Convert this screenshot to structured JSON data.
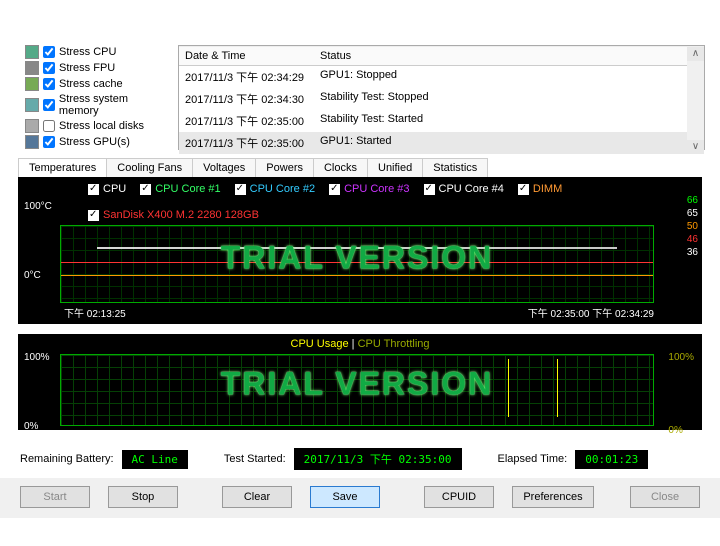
{
  "stress": {
    "cpu": {
      "label": "Stress CPU",
      "checked": true
    },
    "fpu": {
      "label": "Stress FPU",
      "checked": true
    },
    "cache": {
      "label": "Stress cache",
      "checked": true
    },
    "memory": {
      "label": "Stress system memory",
      "checked": true
    },
    "disks": {
      "label": "Stress local disks",
      "checked": false
    },
    "gpu": {
      "label": "Stress GPU(s)",
      "checked": true
    }
  },
  "log": {
    "col_datetime": "Date & Time",
    "col_status": "Status",
    "rows": [
      {
        "dt": "2017/11/3 下午 02:34:29",
        "status": "GPU1: Stopped"
      },
      {
        "dt": "2017/11/3 下午 02:34:30",
        "status": "Stability Test: Stopped"
      },
      {
        "dt": "2017/11/3 下午 02:35:00",
        "status": "Stability Test: Started"
      },
      {
        "dt": "2017/11/3 下午 02:35:00",
        "status": "GPU1: Started"
      }
    ]
  },
  "tabs": [
    "Temperatures",
    "Cooling Fans",
    "Voltages",
    "Powers",
    "Clocks",
    "Unified",
    "Statistics"
  ],
  "active_tab": "Temperatures",
  "temp_chart": {
    "legend": [
      {
        "name": "CPU",
        "color": "#ffffff"
      },
      {
        "name": "CPU Core #1",
        "color": "#33ff66"
      },
      {
        "name": "CPU Core #2",
        "color": "#33ccff"
      },
      {
        "name": "CPU Core #3",
        "color": "#cc33ff"
      },
      {
        "name": "CPU Core #4",
        "color": "#ffffff"
      },
      {
        "name": "DIMM",
        "color": "#ff9933"
      },
      {
        "name": "SanDisk X400 M.2 2280 128GB",
        "color": "#ff3333"
      }
    ],
    "y_top": "100°C",
    "y_bot": "0°C",
    "x_left": "下午 02:13:25",
    "x_right1": "下午 02:35:00",
    "x_right2": "下午 02:34:29",
    "right_vals": [
      {
        "v": "66",
        "c": "#0f0"
      },
      {
        "v": "65",
        "c": "#fff"
      },
      {
        "v": "50",
        "c": "#f90"
      },
      {
        "v": "46",
        "c": "#f33"
      },
      {
        "v": "36",
        "c": "#fff"
      }
    ],
    "watermark": "TRIAL VERSION"
  },
  "cpu_chart": {
    "legend_usage": "CPU Usage",
    "legend_sep": "|",
    "legend_throttling": "CPU Throttling",
    "y_top": "100%",
    "y_bot": "0%",
    "r_top": "100%",
    "r_bot": "0%",
    "watermark": "TRIAL VERSION"
  },
  "status": {
    "remaining_label": "Remaining Battery:",
    "remaining_value": "AC Line",
    "started_label": "Test Started:",
    "started_value": "2017/11/3 下午 02:35:00",
    "elapsed_label": "Elapsed Time:",
    "elapsed_value": "00:01:23"
  },
  "buttons": {
    "start": "Start",
    "stop": "Stop",
    "clear": "Clear",
    "save": "Save",
    "cpuid": "CPUID",
    "preferences": "Preferences",
    "close": "Close"
  },
  "chart_data": {
    "type": "line",
    "title": "Temperatures",
    "ylabel": "°C",
    "ylim": [
      0,
      100
    ],
    "x_range": [
      "下午 02:13:25",
      "下午 02:35:00"
    ],
    "series": [
      {
        "name": "CPU",
        "last": 65
      },
      {
        "name": "CPU Core #1",
        "last": 66
      },
      {
        "name": "CPU Core #2",
        "last": 66
      },
      {
        "name": "CPU Core #3",
        "last": 65
      },
      {
        "name": "CPU Core #4",
        "last": 65
      },
      {
        "name": "DIMM",
        "last": 50
      },
      {
        "name": "SanDisk X400 M.2 2280 128GB",
        "last": 46
      }
    ],
    "secondary": {
      "type": "line",
      "title": "CPU Usage / Throttling",
      "ylabel": "%",
      "ylim": [
        0,
        100
      ],
      "series": [
        {
          "name": "CPU Usage",
          "last": 100
        },
        {
          "name": "CPU Throttling",
          "last": 0
        }
      ]
    }
  }
}
